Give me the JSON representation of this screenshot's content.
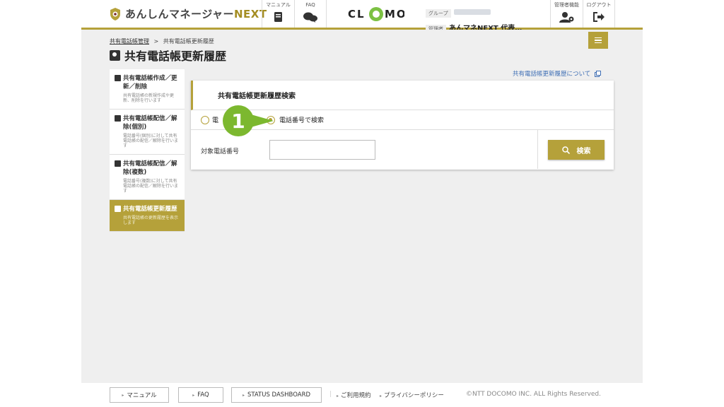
{
  "header": {
    "logo_text": "あんしんマネージャー",
    "logo_next": "NEXT",
    "manual_label": "マニュアル",
    "faq_label": "FAQ",
    "brand": "CLOMO",
    "group_tag": "グループ",
    "admin_tag": "管理者",
    "group_name": "あんマネNEXT 代表…",
    "admin_settings_label": "管理者機能",
    "logout_label": "ログアウト"
  },
  "breadcrumb": {
    "parent": "共有電話帳管理",
    "separator": ">",
    "current": "共有電話帳更新履歴"
  },
  "page_title": "共有電話帳更新履歴",
  "help_link": "共有電話帳更新履歴について",
  "sidebar": {
    "items": [
      {
        "title": "共有電話帳作成／更新／削除",
        "desc": "共有電話帳の新規作成や更新、削除を行います"
      },
      {
        "title": "共有電話帳配信／解除(個別)",
        "desc": "電話番号(個別)に対して共有電話帳の配信／解除を行います"
      },
      {
        "title": "共有電話帳配信／解除(複数)",
        "desc": "電話番号(複数)に対して共有電話帳の配信／解除を行います"
      },
      {
        "title": "共有電話帳更新履歴",
        "desc": "共有電話帳の更新履歴を表示します"
      }
    ]
  },
  "panel": {
    "title": "共有電話帳更新履歴検索",
    "radio1_label": "電",
    "radio2_label": "電話番号で検索",
    "field_label": "対象電話番号",
    "field_value": "",
    "search_button": "検索"
  },
  "callout_number": "1",
  "footer": {
    "manual": "マニュアル",
    "faq": "FAQ",
    "status": "STATUS DASHBOARD",
    "terms": "ご利用規約",
    "privacy": "プライバシーポリシー",
    "copyright": "©NTT DOCOMO INC. ALL Rights Reserved."
  },
  "colors": {
    "accent": "#b5a13a",
    "callout": "#7cb82f",
    "link": "#3f6fb5"
  }
}
